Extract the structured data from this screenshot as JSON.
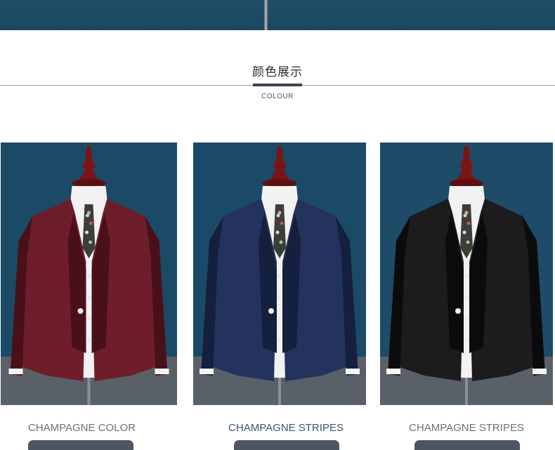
{
  "section": {
    "title": "颜色展示",
    "subtitle": "COLOUR"
  },
  "products": [
    {
      "caption": "CHAMPAGNE COLOR",
      "jacket_color": "#6e1e2a",
      "jacket_dark": "#4a1019",
      "background": "#1b4a66"
    },
    {
      "caption": "CHAMPAGNE STRIPES",
      "jacket_color": "#23335e",
      "jacket_dark": "#151f3e",
      "background": "#1a4a68"
    },
    {
      "caption": "CHAMPAGNE STRIPES",
      "jacket_color": "#1c1c1e",
      "jacket_dark": "#0b0b0c",
      "background": "#1d4b68"
    }
  ],
  "colors": {
    "banner": "#1f4f69",
    "divider_accent": "#3a4650",
    "caption": "#6f6f6f",
    "caption_active": "#3a5572"
  }
}
